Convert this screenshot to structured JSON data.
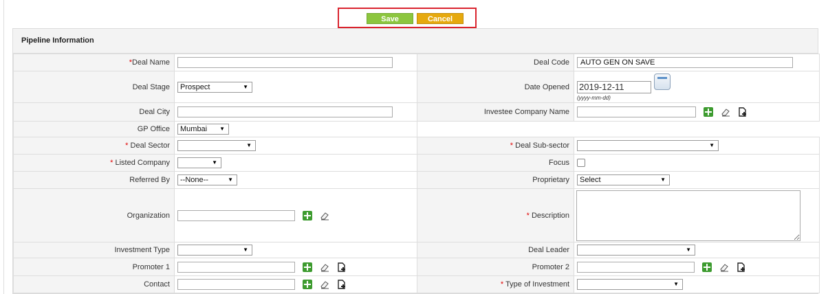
{
  "buttons": {
    "save": "Save",
    "cancel": "Cancel"
  },
  "section_title": "Pipeline Information",
  "fields": {
    "deal_name": {
      "label": "Deal Name",
      "value": ""
    },
    "deal_code": {
      "label": "Deal Code",
      "value": "AUTO GEN ON SAVE"
    },
    "deal_stage": {
      "label": "Deal Stage",
      "value": "Prospect"
    },
    "date_opened": {
      "label": "Date Opened",
      "value": "2019-12-11",
      "format": "(yyyy-mm-dd)"
    },
    "deal_city": {
      "label": "Deal City",
      "value": ""
    },
    "investee_company": {
      "label": "Investee Company Name",
      "value": ""
    },
    "gp_office": {
      "label": "GP Office",
      "value": "Mumbai"
    },
    "deal_sector": {
      "label": "Deal Sector",
      "value": ""
    },
    "deal_subsector": {
      "label": "Deal Sub-sector",
      "value": ""
    },
    "listed_company": {
      "label": "Listed Company",
      "value": ""
    },
    "focus": {
      "label": "Focus",
      "checked": false
    },
    "referred_by": {
      "label": "Referred By",
      "value": "--None--"
    },
    "proprietary": {
      "label": "Proprietary",
      "value": "Select"
    },
    "organization": {
      "label": "Organization",
      "value": ""
    },
    "description": {
      "label": "Description",
      "value": ""
    },
    "investment_type": {
      "label": "Investment Type",
      "value": ""
    },
    "deal_leader": {
      "label": "Deal Leader",
      "value": ""
    },
    "promoter1": {
      "label": "Promoter 1",
      "value": ""
    },
    "promoter2": {
      "label": "Promoter 2",
      "value": ""
    },
    "contact": {
      "label": "Contact",
      "value": ""
    },
    "type_of_investment": {
      "label": "Type of Investment",
      "value": ""
    }
  },
  "required_marker": "*",
  "icons": {
    "add": "add-plus-icon",
    "clear": "eraser-icon",
    "new": "new-document-icon",
    "calendar": "calendar-icon",
    "dropdown": "dropdown-arrow-icon"
  },
  "colors": {
    "save": "#8cc63e",
    "cancel": "#e6a90e",
    "highlight": "#d9232d",
    "add": "#3d9b2f"
  }
}
